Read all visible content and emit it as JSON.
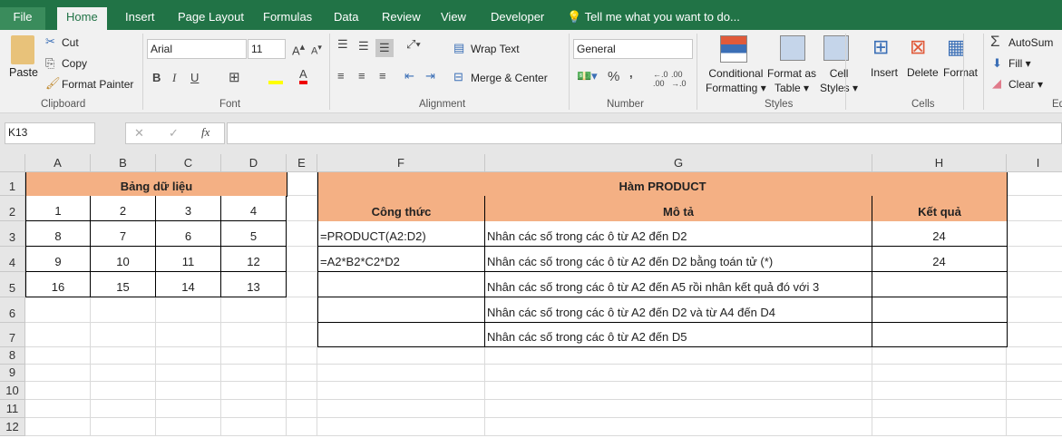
{
  "tabs": [
    "File",
    "Home",
    "Insert",
    "Page Layout",
    "Formulas",
    "Data",
    "Review",
    "View",
    "Developer"
  ],
  "tell_me": "Tell me what you want to do...",
  "clipboard": {
    "paste": "Paste",
    "cut": "Cut",
    "copy": "Copy",
    "format_painter": "Format Painter",
    "label": "Clipboard"
  },
  "font": {
    "name": "Arial",
    "size": "11",
    "label": "Font",
    "bold": "B",
    "italic": "I",
    "underline": "U"
  },
  "alignment": {
    "wrap": "Wrap Text",
    "merge": "Merge & Center",
    "label": "Alignment"
  },
  "number": {
    "format": "General",
    "percent": "%",
    "comma": ",",
    "label": "Number"
  },
  "styles": {
    "conditional1": "Conditional",
    "conditional2": "Formatting",
    "format_table1": "Format as",
    "format_table2": "Table",
    "cell_styles1": "Cell",
    "cell_styles2": "Styles",
    "label": "Styles"
  },
  "cells": {
    "insert": "Insert",
    "delete": "Delete",
    "format": "Format",
    "label": "Cells"
  },
  "editing": {
    "autosum": "AutoSum",
    "fill": "Fill",
    "clear": "Clear",
    "label": "Ed"
  },
  "formula_bar": {
    "name_box": "K13",
    "fx": "fx",
    "value": ""
  },
  "columns": [
    "A",
    "B",
    "C",
    "D",
    "E",
    "F",
    "G",
    "H",
    "I"
  ],
  "rows": [
    "1",
    "2",
    "3",
    "4",
    "5",
    "6",
    "7",
    "8",
    "9",
    "10",
    "11",
    "12"
  ],
  "data_table": {
    "title": "Bảng dữ liệu",
    "rows": [
      [
        "1",
        "2",
        "3",
        "4"
      ],
      [
        "8",
        "7",
        "6",
        "5"
      ],
      [
        "9",
        "10",
        "11",
        "12"
      ],
      [
        "16",
        "15",
        "14",
        "13"
      ]
    ]
  },
  "product_table": {
    "title": "Hàm PRODUCT",
    "headers": [
      "Công thức",
      "Mô tả",
      "Kết quả"
    ],
    "rows": [
      [
        "=PRODUCT(A2:D2)",
        "Nhân các số trong các ô từ A2 đến D2",
        "24"
      ],
      [
        "=A2*B2*C2*D2",
        "Nhân các số trong các ô từ A2 đến D2 bằng toán tử (*)",
        "24"
      ],
      [
        "",
        "Nhân các số trong các ô từ A2 đến A5 rồi nhân kết quả đó với 3",
        ""
      ],
      [
        "",
        "Nhân các số trong các ô từ A2 đến D2 và từ A4 đến D4",
        ""
      ],
      [
        "",
        "Nhân các số trong các ô từ A2 đến D5",
        ""
      ]
    ]
  },
  "colors": {
    "accent": "#217346",
    "header_fill": "#F4B084"
  }
}
